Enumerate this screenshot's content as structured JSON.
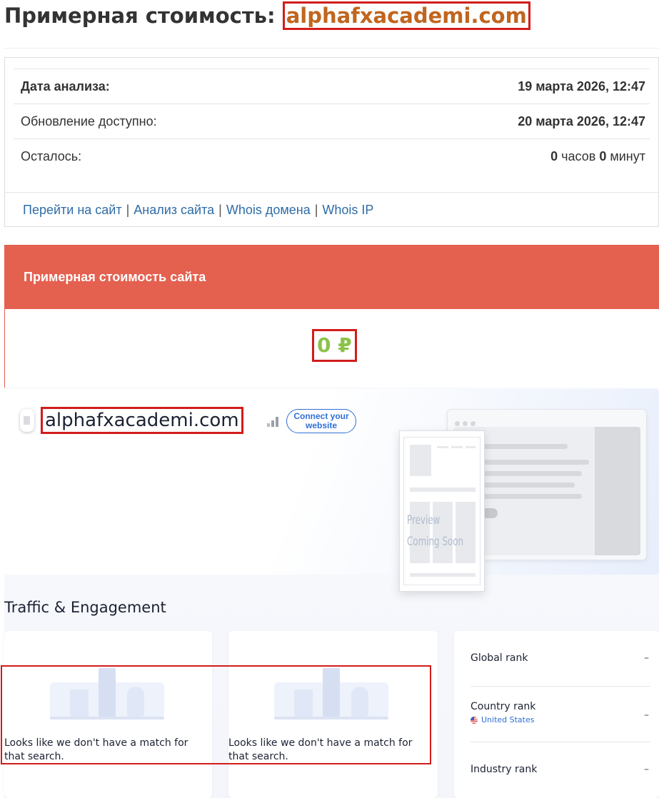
{
  "header": {
    "title_prefix": "Примерная стоимость:",
    "domain": "alphafxacademi.com"
  },
  "info": {
    "rows": [
      {
        "label": "Дата анализа:",
        "value": "19 марта 2026, 12:47"
      },
      {
        "label": "Обновление доступно:",
        "value": "20 марта 2026, 12:47"
      },
      {
        "label": "Осталось:",
        "hours": "0",
        "hours_unit": "часов",
        "minutes": "0",
        "minutes_unit": "минут"
      }
    ],
    "links": [
      "Перейти на сайт",
      "Анализ сайта",
      "Whois домена",
      "Whois IP"
    ],
    "separator": "|"
  },
  "cost": {
    "heading": "Примерная стоимость сайта",
    "value": "0 ₽"
  },
  "similarweb": {
    "domain": "alphafxacademi.com",
    "connect_button": "Connect your website",
    "preview_line1": "Preview",
    "preview_line2": "Coming Soon",
    "section_title": "Traffic & Engagement",
    "no_match_text": "Looks like we don't have a match for that search.",
    "ranks": {
      "global_label": "Global rank",
      "global_value": "–",
      "country_label": "Country rank",
      "country_name": "United States",
      "country_value": "–",
      "industry_label": "Industry rank",
      "industry_value": "–"
    }
  },
  "colors": {
    "accent_red": "#e4604f",
    "domain_orange": "#c0661f",
    "cost_green": "#8bc34a",
    "link_blue": "#2e6ca7",
    "highlight_red": "#d21c1c",
    "sw_blue": "#2f6fd6"
  }
}
